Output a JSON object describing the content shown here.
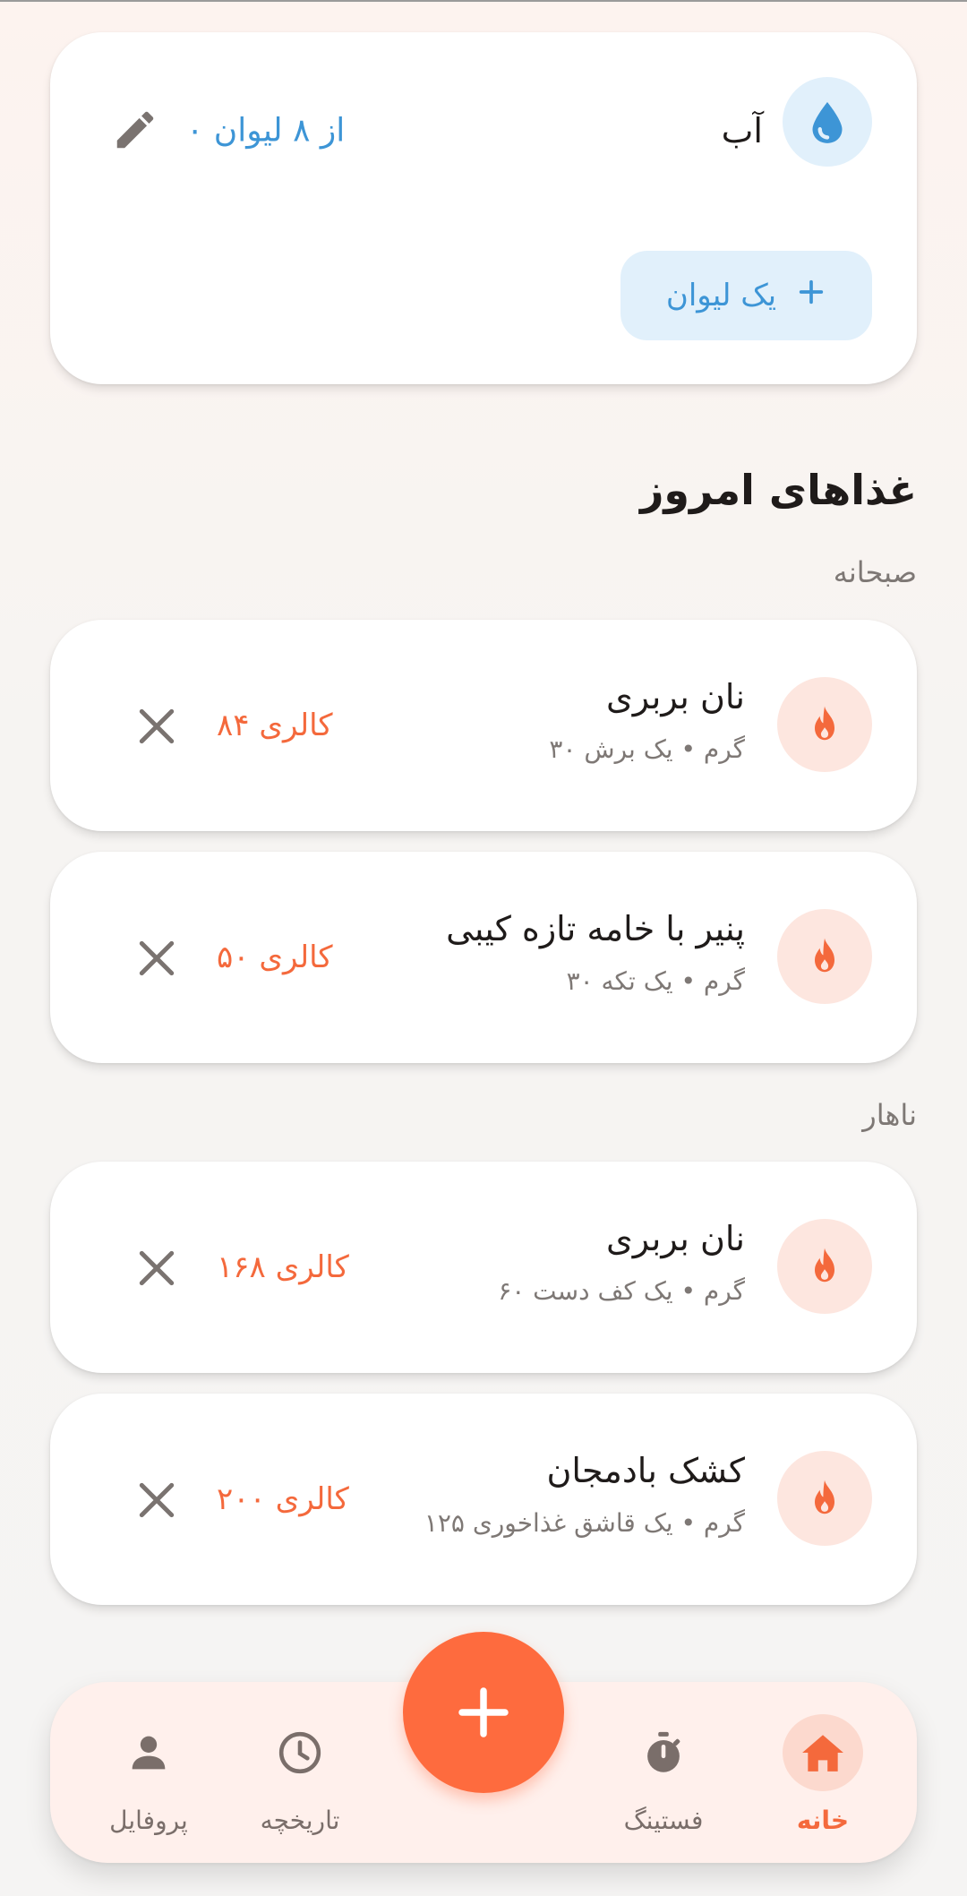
{
  "colors": {
    "accent": "#fe6b3e",
    "water_blue": "#3d95d6",
    "water_bg": "#e1f0fb",
    "calorie": "#f4693c",
    "food_icon_bg": "#fde6df"
  },
  "water": {
    "title": "آب",
    "count": "۰ از ۸ لیوان",
    "add_label": "یک لیوان",
    "icon": "water-drop-icon"
  },
  "today_meals_title": "غذاهای امروز",
  "meals": [
    {
      "label": "صبحانه",
      "items": [
        {
          "name": "نان بربری",
          "detail": "۳۰ گرم • یک برش",
          "calories": "۸۴ کالری"
        },
        {
          "name": "پنیر با خامه تازه کیبی",
          "detail": "۳۰ گرم • یک تکه",
          "calories": "۵۰ کالری"
        }
      ]
    },
    {
      "label": "ناهار",
      "items": [
        {
          "name": "نان بربری",
          "detail": "۶۰ گرم • یک کف دست",
          "calories": "۱۶۸ کالری"
        },
        {
          "name": "کشک بادمجان",
          "detail": "۱۲۵ گرم • یک قاشق غذاخوری",
          "calories": "۲۰۰ کالری"
        }
      ]
    }
  ],
  "nav": {
    "home": "خانه",
    "fasting": "فستینگ",
    "history": "تاریخچه",
    "profile": "پروفایل",
    "active": "home"
  }
}
